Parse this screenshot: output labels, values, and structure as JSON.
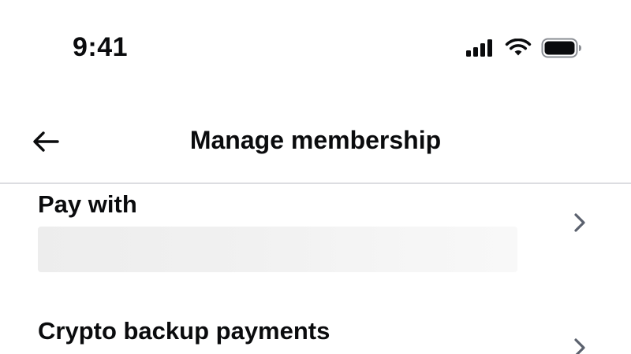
{
  "status_bar": {
    "time": "9:41",
    "icons": [
      "cellular-signal-icon",
      "wifi-icon",
      "battery-icon"
    ]
  },
  "header": {
    "back_icon": "arrow-left-icon",
    "title": "Manage membership"
  },
  "rows": [
    {
      "label": "Pay with",
      "value_loading": true,
      "chevron_icon": "chevron-right-icon"
    },
    {
      "label": "Crypto backup payments",
      "chevron_icon": "chevron-right-icon"
    }
  ],
  "colors": {
    "text": "#0a0b0d",
    "divider": "#dcdde1",
    "chevron": "#5b616e",
    "skeleton": "#ededed",
    "background": "#ffffff"
  }
}
